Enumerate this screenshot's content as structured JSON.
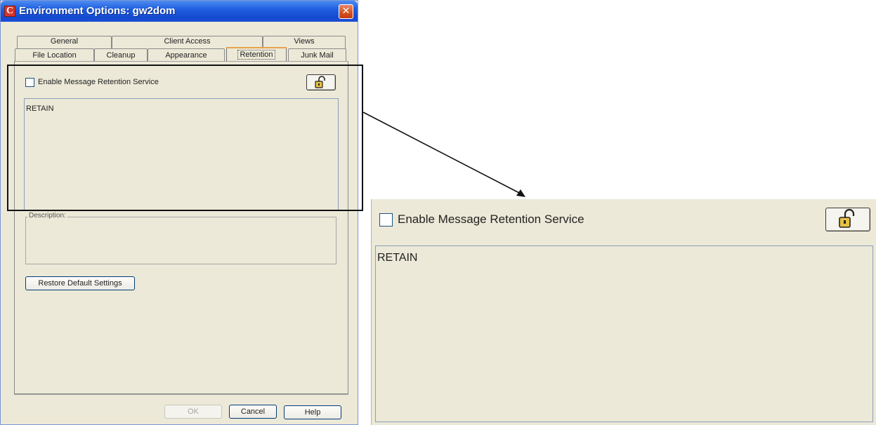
{
  "window": {
    "title": "Environment Options:  gw2dom",
    "app_icon_letter": "C",
    "close_glyph": "✕"
  },
  "tabs": {
    "row1": [
      "General",
      "Client Access",
      "Views"
    ],
    "row2": [
      "File Location",
      "Cleanup",
      "Appearance",
      "Retention",
      "Junk Mail"
    ],
    "selected": "Retention"
  },
  "retention": {
    "enable_label": "Enable Message Retention Service",
    "enable_checked": false,
    "list_text": "RETAIN",
    "lock_icon": "unlock-icon"
  },
  "description": {
    "label": "Description:",
    "value": ""
  },
  "buttons": {
    "restore": "Restore Default Settings",
    "ok": "OK",
    "cancel": "Cancel",
    "help": "Help"
  },
  "zoom": {
    "enable_label": "Enable Message Retention Service",
    "list_text": "RETAIN"
  },
  "colors": {
    "titlebar": "#1f5fe0",
    "dialog_bg": "#ece9d8",
    "close_button": "#d4501e",
    "selected_tab_accent": "#e8a24a"
  }
}
